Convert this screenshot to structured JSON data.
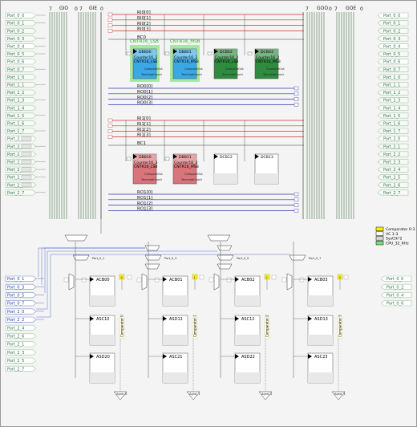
{
  "header": {
    "gio_label": "GIO",
    "gie_label": "GIE",
    "goo_label": "GOO",
    "goe_label": "GOE",
    "left_7a": "7",
    "left_0a": "0",
    "left_7b": "7",
    "left_0b": "0",
    "right_7a": "7",
    "right_0a": "0",
    "right_7b": "7",
    "right_0b": "0"
  },
  "left_pins": [
    "Port_0_0",
    "Port_0_1",
    "Port_0_2",
    "Port_0_3",
    "Port_0_4",
    "Port_0_5",
    "Port_0_6",
    "Port_0_7",
    "Port_1_0",
    "Port_1_1",
    "Port_1_2",
    "Port_1_3",
    "Port_1_4",
    "Port_1_5",
    "Port_1_6",
    "Port_1_7",
    "Port_2_0",
    "Port_2_1",
    "Port_2_2",
    "Port_2_3",
    "Port_2_4",
    "Port_2_5",
    "Port_2_6",
    "Port_2_7"
  ],
  "right_pins": [
    "Port_0_0",
    "Port_0_1",
    "Port_0_2",
    "Port_0_3",
    "Port_0_4",
    "Port_0_5",
    "Port_0_6",
    "Port_0_7",
    "Port_1_0",
    "Port_1_1",
    "Port_1_2",
    "Port_1_3",
    "Port_1_4",
    "Port_1_5",
    "Port_1_6",
    "Port_1_7",
    "Port_2_0",
    "Port_2_1",
    "Port_2_2",
    "Port_2_3",
    "Port_2_4",
    "Port_2_5",
    "Port_2_6",
    "Port_2_7"
  ],
  "left_analog_pins": [
    "Port_0_1",
    "Port_0_3",
    "Port_0_5",
    "Port_0_7",
    "Port_2_0",
    "Port_2_2",
    "Port_2_4",
    "Port_2_6",
    "Port_2_1",
    "Port_2_3",
    "Port_2_5",
    "Port_2_7"
  ],
  "right_analog_pins": [
    "Port_0_0",
    "Port_0_2",
    "Port_0_4",
    "Port_0_6"
  ],
  "row0_buses": [
    "RI0[0]",
    "RI0[1]",
    "RI0[2]",
    "RI0[3]"
  ],
  "row0_bc": "BC0",
  "row0_out": [
    "RO0[0]",
    "RO0[1]",
    "RO0[2]",
    "RO0[3]"
  ],
  "row1_buses": [
    "RI1[0]",
    "RI1[1]",
    "RI1[2]",
    "RI1[3]"
  ],
  "row1_bc": "BC1",
  "row1_out": [
    "RO1[0]",
    "RO1[1]",
    "RO1[2]",
    "RO1[3]"
  ],
  "digital_row0": [
    {
      "id": "DBB00",
      "name": "Counter16_1",
      "user": "CNTR16_LSB",
      "top": "CNTR16_LSB"
    },
    {
      "id": "DBB01",
      "name": "Counter16_1",
      "user": "CNTR16_MSB",
      "top": "CNTR16_MSB"
    },
    {
      "id": "DCB02",
      "name": "Counter16_2",
      "user": "CNTR16_LSB",
      "top": ""
    },
    {
      "id": "DCB03",
      "name": "Counter16_2",
      "user": "CNTR16_MSB",
      "top": ""
    }
  ],
  "digital_row1": [
    {
      "id": "DBB10",
      "name": "Counter16_3",
      "user": "CNTR16_LSB"
    },
    {
      "id": "DBB11",
      "name": "Counter16_3",
      "user": "CNTR16_MSB"
    },
    {
      "id": "DCB12",
      "name": "",
      "user": ""
    },
    {
      "id": "DCB13",
      "name": "",
      "user": ""
    }
  ],
  "block_pins": {
    "data": "Data",
    "clock": "Clock",
    "enable": "Enable",
    "compare": "CompareOut",
    "terminal": "TerminalCount"
  },
  "analog_cols": [
    "Port_0_1",
    "Port_0_3",
    "Port_0_5",
    "Port_0_7"
  ],
  "analog_buf": [
    "Port_0_1",
    "Port_0_3",
    "Port_0_5",
    "Port_0_7"
  ],
  "analog_row0": [
    "ACB00",
    "ACB01",
    "ACB02",
    "ACB03"
  ],
  "analog_row1": [
    "ASC10",
    "ASD11",
    "ASC12",
    "ASD13"
  ],
  "analog_row2": [
    "ASD20",
    "ASC21",
    "ASD22",
    "ASC23"
  ],
  "comparator_labels": [
    "Comparator 0",
    "Comparator 1",
    "Comparator 2",
    "Comparator 3"
  ],
  "bus_letters": [
    "0",
    "1",
    "2",
    "3"
  ],
  "analog_out": [
    "Agnd_0",
    "Agnd_1",
    "Agnd_2",
    "Agnd_3"
  ],
  "legend": [
    {
      "label": "Comparator 0-3",
      "color": "#fff200"
    },
    {
      "label": "VC 1-3",
      "color": "#ffffff"
    },
    {
      "label": "SysClk*2",
      "color": "#d8d8d8"
    },
    {
      "label": "CPU_32_KHz",
      "color": "#7be07b"
    }
  ]
}
